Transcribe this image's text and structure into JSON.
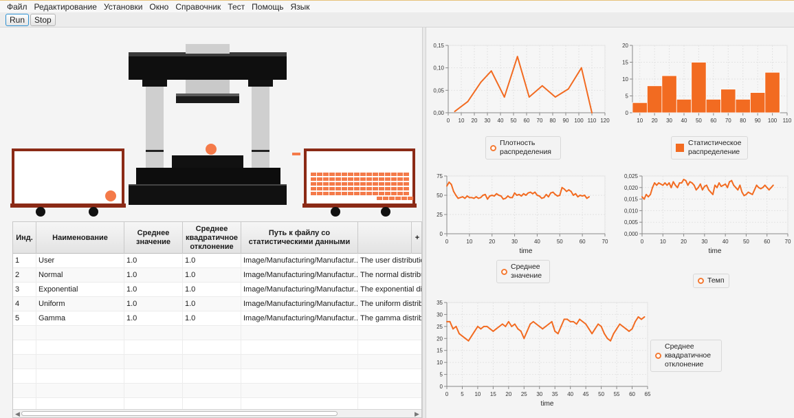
{
  "menu": [
    "Файл",
    "Редактирование",
    "Установки",
    "Окно",
    "Справочник",
    "Тест",
    "Помощь",
    "Язык"
  ],
  "toolbar": {
    "run_label": "Run",
    "stop_label": "Stop"
  },
  "table": {
    "headers": [
      "Инд.",
      "Наименование",
      "Среднее значение",
      "Среднее квадратичное отклонение",
      "Путь к файлу со статистическими данными",
      "",
      "+"
    ],
    "rows": [
      [
        "1",
        "User",
        "1.0",
        "1.0",
        "Image/Manufacturing/Manufactur...",
        "The user distributio"
      ],
      [
        "2",
        "Normal",
        "1.0",
        "1.0",
        "Image/Manufacturing/Manufactur...",
        "The normal distribu"
      ],
      [
        "3",
        "Exponential",
        "1.0",
        "1.0",
        "Image/Manufacturing/Manufactur...",
        "The exponential dis"
      ],
      [
        "4",
        "Uniform",
        "1.0",
        "1.0",
        "Image/Manufacturing/Manufactur...",
        "The uniform distrib"
      ],
      [
        "5",
        "Gamma",
        "1.0",
        "1.0",
        "Image/Manufacturing/Manufactur...",
        "The gamma distribu"
      ]
    ]
  },
  "colors": {
    "series": "#f26b21",
    "accent": "#2b8fd1",
    "machine": "#111111",
    "cart_frame": "#8b2a16"
  },
  "chart_data": [
    {
      "type": "line",
      "xlabel": "",
      "ylabel": "",
      "xlim": [
        0,
        120
      ],
      "ylim": [
        0,
        0.15
      ],
      "x_ticks": [
        0,
        10,
        20,
        30,
        40,
        50,
        60,
        70,
        80,
        90,
        100,
        110,
        120
      ],
      "y_ticks": [
        "0,00",
        "0,05",
        "0,10",
        "0,15"
      ],
      "series": [
        {
          "name": "Плотность распределения",
          "x": [
            5,
            15,
            25,
            33,
            43,
            53,
            62,
            72,
            82,
            92,
            102,
            110
          ],
          "values": [
            0.003,
            0.025,
            0.068,
            0.093,
            0.035,
            0.125,
            0.035,
            0.06,
            0.035,
            0.053,
            0.1,
            0.0
          ]
        }
      ]
    },
    {
      "type": "bar",
      "xlabel": "",
      "ylabel": "",
      "xlim": [
        5,
        110
      ],
      "ylim": [
        0,
        20
      ],
      "x_ticks": [
        10,
        20,
        30,
        40,
        50,
        60,
        70,
        80,
        90,
        100,
        110
      ],
      "y_ticks": [
        "0",
        "5",
        "10",
        "15",
        "20"
      ],
      "series": [
        {
          "name": "Статистическое распределение",
          "x": [
            10,
            20,
            30,
            40,
            50,
            60,
            70,
            80,
            90,
            100
          ],
          "values": [
            3,
            8,
            11,
            4,
            15,
            4,
            7,
            4,
            6,
            12
          ]
        }
      ]
    },
    {
      "type": "line",
      "xlabel": "time",
      "ylabel": "",
      "xlim": [
        0,
        70
      ],
      "ylim": [
        0,
        75
      ],
      "x_ticks": [
        0,
        10,
        20,
        30,
        40,
        50,
        60,
        70
      ],
      "y_ticks": [
        "0",
        "25",
        "50",
        "75"
      ],
      "series": [
        {
          "name": "Среднее значение",
          "x": [
            0,
            1,
            2,
            3,
            4,
            5,
            6,
            7,
            8,
            9,
            10,
            11,
            12,
            13,
            14,
            15,
            16,
            17,
            18,
            19,
            20,
            21,
            22,
            23,
            24,
            25,
            26,
            27,
            28,
            29,
            30,
            31,
            32,
            33,
            34,
            35,
            36,
            37,
            38,
            39,
            40,
            41,
            42,
            43,
            44,
            45,
            46,
            47,
            48,
            49,
            50,
            51,
            52,
            53,
            54,
            55,
            56,
            57,
            58,
            59,
            60,
            61,
            62,
            63
          ],
          "values": [
            62,
            67,
            64,
            55,
            50,
            46,
            47,
            48,
            46,
            49,
            47,
            47,
            46,
            48,
            46,
            47,
            50,
            51,
            45,
            49,
            50,
            49,
            52,
            50,
            49,
            45,
            46,
            49,
            47,
            47,
            53,
            50,
            51,
            49,
            52,
            50,
            53,
            54,
            52,
            54,
            50,
            49,
            46,
            47,
            51,
            48,
            53,
            54,
            51,
            49,
            50,
            60,
            58,
            55,
            57,
            55,
            50,
            52,
            48,
            50,
            49,
            50,
            46,
            48
          ]
        }
      ]
    },
    {
      "type": "line",
      "xlabel": "time",
      "ylabel": "",
      "xlim": [
        0,
        70
      ],
      "ylim": [
        0,
        0.025
      ],
      "x_ticks": [
        0,
        10,
        20,
        30,
        40,
        50,
        60,
        70
      ],
      "y_ticks": [
        "0,000",
        "0,005",
        "0,010",
        "0,015",
        "0,020",
        "0,025"
      ],
      "series": [
        {
          "name": "Темп",
          "x": [
            0,
            1,
            2,
            3,
            4,
            5,
            6,
            7,
            8,
            9,
            10,
            11,
            12,
            13,
            14,
            15,
            16,
            17,
            18,
            19,
            20,
            21,
            22,
            23,
            24,
            25,
            26,
            27,
            28,
            29,
            30,
            31,
            32,
            33,
            34,
            35,
            36,
            37,
            38,
            39,
            40,
            41,
            42,
            43,
            44,
            45,
            46,
            47,
            48,
            49,
            50,
            51,
            52,
            53,
            54,
            55,
            56,
            57,
            58,
            59,
            60,
            61,
            62,
            63
          ],
          "values": [
            0.016,
            0.015,
            0.017,
            0.016,
            0.017,
            0.02,
            0.022,
            0.021,
            0.022,
            0.0215,
            0.021,
            0.022,
            0.021,
            0.022,
            0.02,
            0.0225,
            0.021,
            0.02,
            0.022,
            0.022,
            0.0235,
            0.023,
            0.021,
            0.0225,
            0.022,
            0.021,
            0.019,
            0.02,
            0.0215,
            0.019,
            0.0205,
            0.021,
            0.019,
            0.018,
            0.017,
            0.021,
            0.02,
            0.022,
            0.0205,
            0.021,
            0.0215,
            0.02,
            0.0225,
            0.023,
            0.021,
            0.02,
            0.019,
            0.021,
            0.018,
            0.0165,
            0.017,
            0.018,
            0.0175,
            0.017,
            0.019,
            0.021,
            0.02,
            0.0195,
            0.02,
            0.021,
            0.02,
            0.019,
            0.02,
            0.021
          ]
        }
      ]
    },
    {
      "type": "line",
      "xlabel": "time",
      "ylabel": "",
      "xlim": [
        0,
        65
      ],
      "ylim": [
        0,
        35
      ],
      "x_ticks": [
        0,
        5,
        10,
        15,
        20,
        25,
        30,
        35,
        40,
        45,
        50,
        55,
        60,
        65
      ],
      "y_ticks": [
        "0",
        "5",
        "10",
        "15",
        "20",
        "25",
        "30",
        "35"
      ],
      "series": [
        {
          "name": "Среднее квадратичное отклонение",
          "x": [
            0,
            1,
            2,
            3,
            4,
            5,
            6,
            7,
            8,
            9,
            10,
            11,
            12,
            13,
            14,
            15,
            16,
            17,
            18,
            19,
            20,
            21,
            22,
            23,
            24,
            25,
            26,
            27,
            28,
            29,
            30,
            31,
            32,
            33,
            34,
            35,
            36,
            37,
            38,
            39,
            40,
            41,
            42,
            43,
            44,
            45,
            46,
            47,
            48,
            49,
            50,
            51,
            52,
            53,
            54,
            55,
            56,
            57,
            58,
            59,
            60,
            61,
            62,
            63,
            64
          ],
          "values": [
            27,
            27,
            24,
            25,
            22,
            21,
            20,
            19,
            21,
            23,
            25,
            24,
            25,
            25,
            24,
            23,
            24,
            25,
            26,
            25,
            27,
            25,
            26,
            24,
            23,
            20,
            23,
            26,
            27,
            26,
            25,
            24,
            25,
            26,
            27,
            23,
            22,
            25,
            28,
            28,
            27,
            27,
            26,
            28,
            27,
            26,
            24,
            22,
            24,
            26,
            25,
            22,
            20,
            19,
            22,
            24,
            26,
            25,
            24,
            23,
            24,
            27,
            29,
            28,
            29
          ]
        }
      ]
    }
  ]
}
